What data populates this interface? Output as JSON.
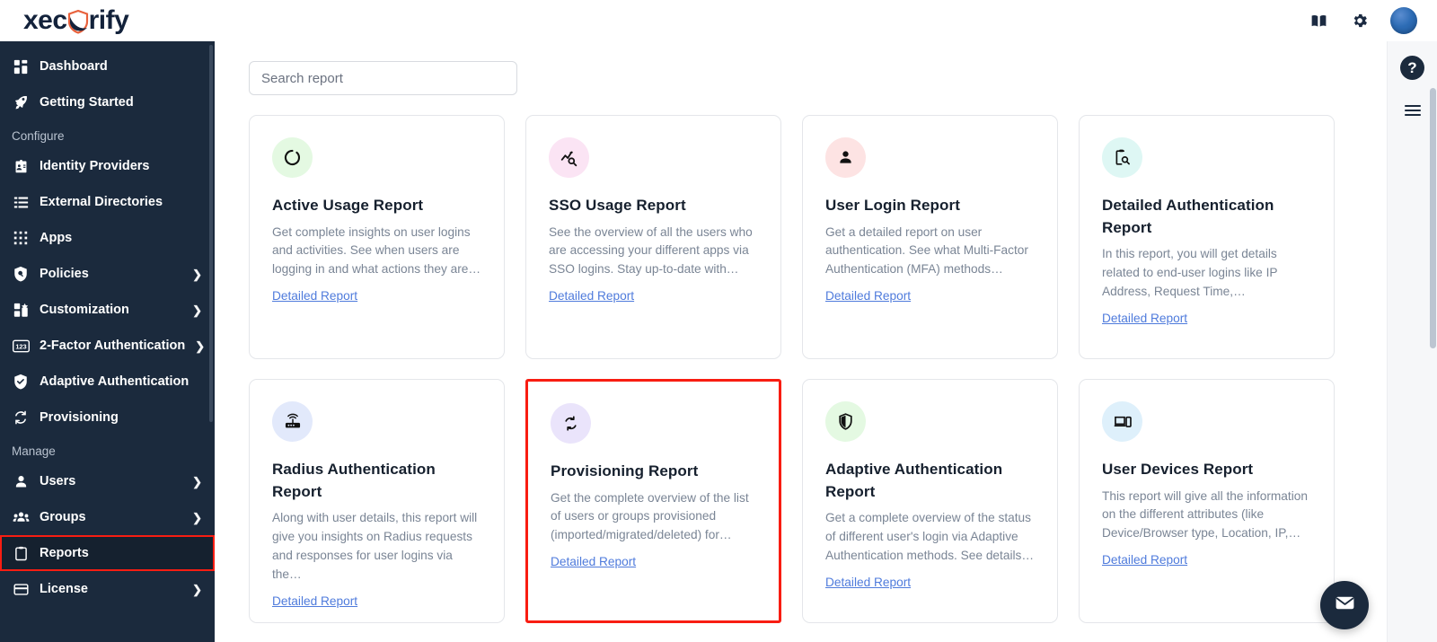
{
  "brand": {
    "name_part1": "xec",
    "name_part2": "rify",
    "accent": "#e8613c",
    "dark": "#13223b"
  },
  "topbar": {
    "icons": [
      {
        "name": "docs-book-icon",
        "label": "Documentation"
      },
      {
        "name": "gear-icon",
        "label": "Settings"
      }
    ],
    "avatar_label": "User account"
  },
  "sidebar": {
    "items": [
      {
        "label": "Dashboard",
        "icon": "dashboard-icon",
        "chevron": false,
        "active": false
      },
      {
        "label": "Getting Started",
        "icon": "rocket-icon",
        "chevron": false,
        "active": false
      }
    ],
    "sections": [
      {
        "title": "Configure",
        "items": [
          {
            "label": "Identity Providers",
            "icon": "id-badge-icon",
            "chevron": false,
            "active": false
          },
          {
            "label": "External Directories",
            "icon": "list-icon",
            "chevron": false,
            "active": false
          },
          {
            "label": "Apps",
            "icon": "grid-apps-icon",
            "chevron": false,
            "active": false
          },
          {
            "label": "Policies",
            "icon": "policy-shield-icon",
            "chevron": true,
            "active": false
          },
          {
            "label": "Customization",
            "icon": "customization-icon",
            "chevron": true,
            "active": false
          },
          {
            "label": "2-Factor Authentication",
            "icon": "numpad-123-icon",
            "chevron": true,
            "active": false
          },
          {
            "label": "Adaptive Authentication",
            "icon": "shield-check-icon",
            "chevron": false,
            "active": false
          },
          {
            "label": "Provisioning",
            "icon": "sync-icon",
            "chevron": false,
            "active": false
          }
        ]
      },
      {
        "title": "Manage",
        "items": [
          {
            "label": "Users",
            "icon": "user-icon",
            "chevron": true,
            "active": false
          },
          {
            "label": "Groups",
            "icon": "groups-icon",
            "chevron": true,
            "active": false
          },
          {
            "label": "Reports",
            "icon": "clipboard-icon",
            "chevron": false,
            "active": true
          },
          {
            "label": "License",
            "icon": "card-icon",
            "chevron": true,
            "active": false
          }
        ]
      }
    ]
  },
  "search": {
    "placeholder": "Search report",
    "value": ""
  },
  "reports": [
    {
      "title": "Active Usage Report",
      "description": "Get complete insights on user logins and activities. See when users are logging in and what actions they are…",
      "link": "Detailed Report",
      "icon": "loading-circle-icon",
      "icon_bg": "#e4f9e2",
      "highlighted": false
    },
    {
      "title": "SSO Usage Report",
      "description": "See the overview of all the users who are accessing your different apps via SSO logins. Stay up-to-date with…",
      "link": "Detailed Report",
      "icon": "chart-search-icon",
      "icon_bg": "#fbe4f4",
      "highlighted": false
    },
    {
      "title": "User Login Report",
      "description": "Get a detailed report on user authentication. See what Multi-Factor Authentication (MFA) methods…",
      "link": "Detailed Report",
      "icon": "person-icon",
      "icon_bg": "#fde3e3",
      "highlighted": false
    },
    {
      "title": "Detailed Authentication Report",
      "description": "In this report, you will get details related to end-user logins like IP Address, Request Time,…",
      "link": "Detailed Report",
      "icon": "clipboard-search-icon",
      "icon_bg": "#def7f4",
      "highlighted": false
    },
    {
      "title": "Radius Authentication Report",
      "description": "Along with user details, this report will give you insights on Radius requests and responses for user logins via the…",
      "link": "Detailed Report",
      "icon": "router-icon",
      "icon_bg": "#e2e9fb",
      "highlighted": false
    },
    {
      "title": "Provisioning Report",
      "description": "Get the complete overview of the list of users or groups provisioned (imported/migrated/deleted) for…",
      "link": "Detailed Report",
      "icon": "sync-icon",
      "icon_bg": "#eae4fb",
      "highlighted": true
    },
    {
      "title": "Adaptive Authentication Report",
      "description": "Get a complete overview of the status of different user's login via Adaptive Authentication methods. See details…",
      "link": "Detailed Report",
      "icon": "shield-half-icon",
      "icon_bg": "#e4f9e2",
      "highlighted": false
    },
    {
      "title": "User Devices Report",
      "description": "This report will give all the information on the different attributes (like Device/Browser type, Location, IP,…",
      "link": "Detailed Report",
      "icon": "devices-icon",
      "icon_bg": "#def0fb",
      "highlighted": false
    }
  ],
  "right_rail": {
    "help_label": "?",
    "menu_label": "Menu"
  },
  "chat": {
    "label": "Open chat"
  },
  "colors": {
    "sidebar_bg": "#1b2a3d",
    "highlight_red": "#f81d12",
    "link_blue": "#4f7bdc"
  }
}
